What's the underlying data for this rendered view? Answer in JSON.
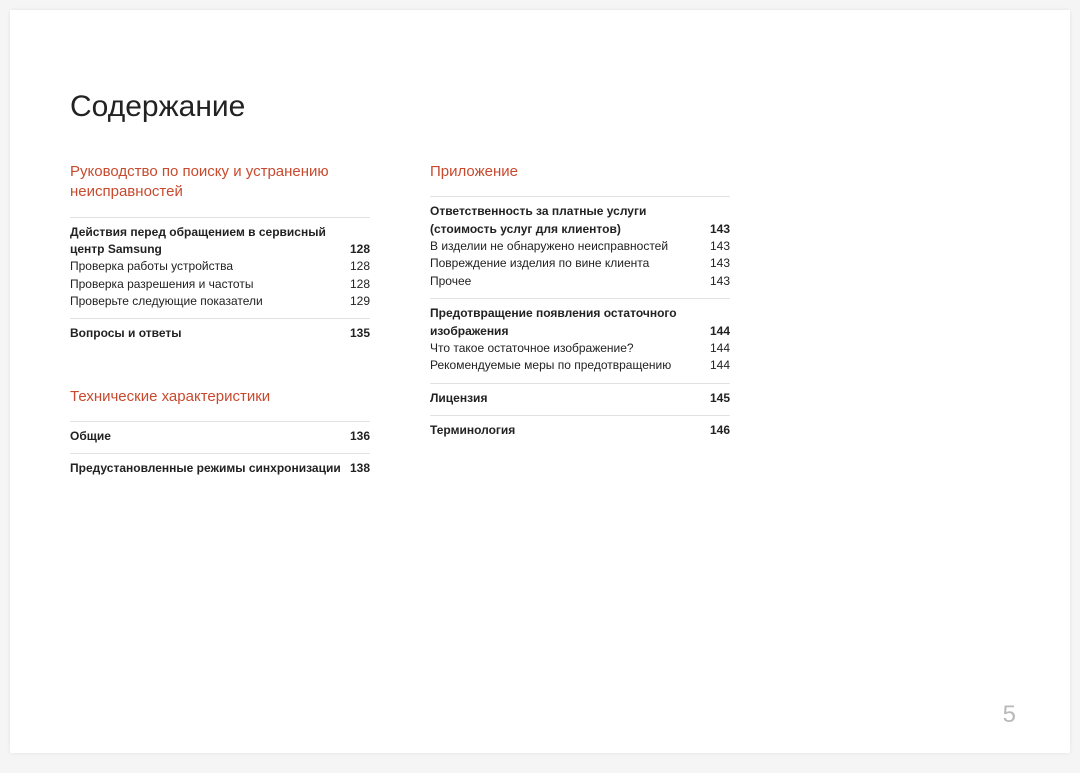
{
  "title": "Содержание",
  "pageNumber": "5",
  "left": {
    "section1": {
      "heading": "Руководство по поиску и устранению неисправностей",
      "groups": [
        {
          "rows": [
            {
              "label": "Действия перед обращением в сервисный центр Samsung",
              "page": "128",
              "bold": true
            },
            {
              "label": "Проверка работы устройства",
              "page": "128",
              "bold": false
            },
            {
              "label": "Проверка разрешения и частоты",
              "page": "128",
              "bold": false
            },
            {
              "label": "Проверьте следующие показатели",
              "page": "129",
              "bold": false
            }
          ]
        },
        {
          "rows": [
            {
              "label": "Вопросы и ответы",
              "page": "135",
              "bold": true
            }
          ]
        }
      ]
    },
    "section2": {
      "heading": "Технические характеристики",
      "groups": [
        {
          "rows": [
            {
              "label": "Общие",
              "page": "136",
              "bold": true
            }
          ]
        },
        {
          "rows": [
            {
              "label": "Предустановленные режимы синхронизации",
              "page": "138",
              "bold": true
            }
          ]
        }
      ]
    }
  },
  "right": {
    "section1": {
      "heading": "Приложение",
      "groups": [
        {
          "rows": [
            {
              "label": "Ответственность за платные услуги (стоимость услуг для клиентов)",
              "page": "143",
              "bold": true
            },
            {
              "label": "В изделии не обнаружено неисправностей",
              "page": "143",
              "bold": false
            },
            {
              "label": "Повреждение изделия по вине клиента",
              "page": "143",
              "bold": false
            },
            {
              "label": "Прочее",
              "page": "143",
              "bold": false
            }
          ]
        },
        {
          "rows": [
            {
              "label": "Предотвращение появления остаточного изображения",
              "page": "144",
              "bold": true
            },
            {
              "label": "Что такое остаточное изображение?",
              "page": "144",
              "bold": false
            },
            {
              "label": "Рекомендуемые меры по предотвращению",
              "page": "144",
              "bold": false
            }
          ]
        },
        {
          "rows": [
            {
              "label": "Лицензия",
              "page": "145",
              "bold": true
            }
          ]
        },
        {
          "rows": [
            {
              "label": "Терминология",
              "page": "146",
              "bold": true
            }
          ]
        }
      ]
    }
  }
}
